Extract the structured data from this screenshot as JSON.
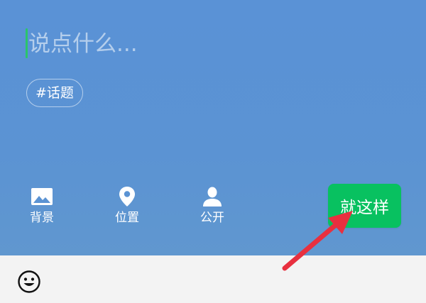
{
  "composer": {
    "placeholder": "说点什么...",
    "value": ""
  },
  "topic_chip": {
    "label": "#话题"
  },
  "tools": [
    {
      "label": "背景",
      "icon": "image-icon"
    },
    {
      "label": "位置",
      "icon": "location-pin-icon"
    },
    {
      "label": "公开",
      "icon": "person-icon"
    }
  ],
  "submit": {
    "label": "就这样"
  },
  "bottom_bar": {
    "emoji_icon": "smiley-face-icon"
  },
  "colors": {
    "compose_background": "#5b93d3",
    "submit_green": "#08c160",
    "cursor_green": "#2bc46b",
    "bottom_bar": "#f3f3f3",
    "annotation_arrow": "#e8303f"
  }
}
